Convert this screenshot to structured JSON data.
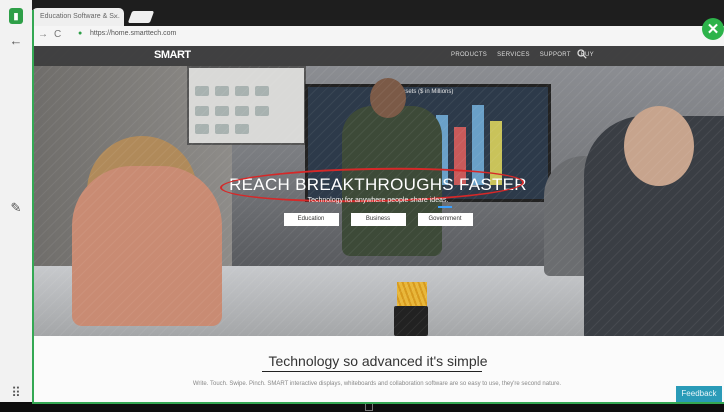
{
  "browser": {
    "tab_title": "Education Software & S...",
    "tab_close": "×",
    "url": "https://home.smarttech.com",
    "back_icon": "←",
    "forward_icon": "→",
    "reload_icon": "C",
    "lock_icon": "●",
    "star_icon": "☆"
  },
  "annotation_toolbar": {
    "close_icon": "✕",
    "pen_icon": "✎",
    "grid_icon": "⠿",
    "app_icon": "▮"
  },
  "site": {
    "logo": "SMART",
    "nav": [
      "PRODUCTS",
      "SERVICES",
      "SUPPORT",
      "BUY"
    ],
    "search_icon": "🔍",
    "hero": {
      "headline": "REACH BREAKTHROUGHS FASTER",
      "subtitle": "Technology for anywhere people share ideas.",
      "screen_title": "and Net Assets ($ in Millions)",
      "buttons": [
        "Education",
        "Business",
        "Government"
      ]
    },
    "section": {
      "title": "Technology so advanced it's simple",
      "body": "Write. Touch. Swipe. Pinch. SMART interactive displays, whiteboards and collaboration software are so easy to use, they're second nature."
    },
    "feedback": "Feedback"
  },
  "colors": {
    "annotation_green": "#34a853",
    "ink_red": "#d62828",
    "feedback": "#2a9bb8"
  }
}
